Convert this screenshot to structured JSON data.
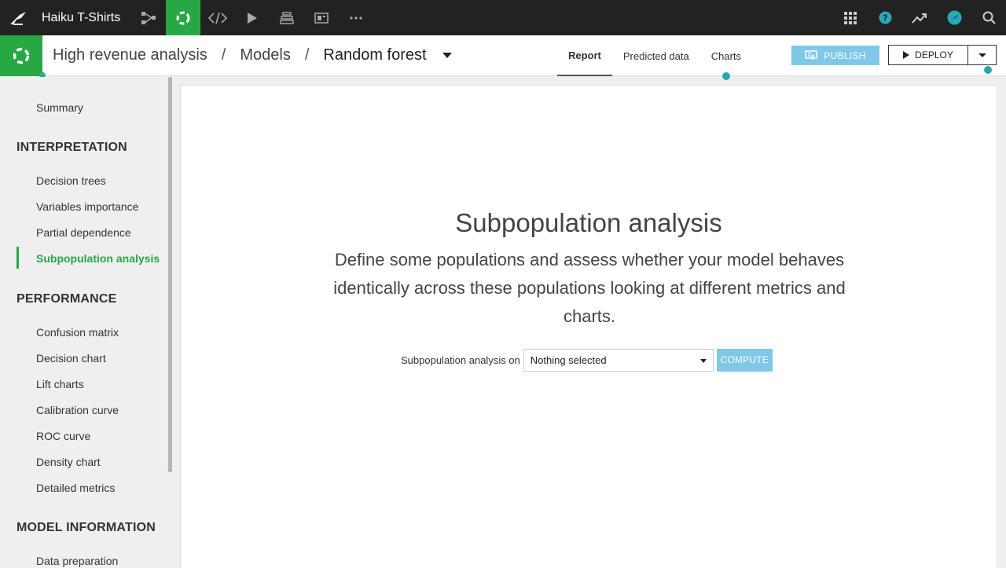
{
  "topbar": {
    "project_name": "Haiku T-Shirts",
    "nav_icons": [
      "flow-icon",
      "lab-icon",
      "code-icon",
      "run-icon",
      "deploy-stack-icon",
      "dashboard-icon",
      "more-icon"
    ],
    "right_icons": [
      "apps-grid-icon",
      "help-icon",
      "trend-icon",
      "user-avatar-icon",
      "search-icon"
    ],
    "accent": "#28a745",
    "dark": "#222222"
  },
  "breadcrumb": {
    "items": [
      "High revenue analysis",
      "Models",
      "Random forest"
    ]
  },
  "tabs": [
    {
      "label": "Report",
      "active": true
    },
    {
      "label": "Predicted data",
      "active": false
    },
    {
      "label": "Charts",
      "active": false
    }
  ],
  "actions": {
    "publish_label": "PUBLISH",
    "deploy_label": "DEPLOY"
  },
  "sidebar": {
    "summary": "Summary",
    "sections": [
      {
        "title": "INTERPRETATION",
        "items": [
          "Decision trees",
          "Variables importance",
          "Partial dependence",
          "Subpopulation analysis"
        ]
      },
      {
        "title": "PERFORMANCE",
        "items": [
          "Confusion matrix",
          "Decision chart",
          "Lift charts",
          "Calibration curve",
          "ROC curve",
          "Density chart",
          "Detailed metrics"
        ]
      },
      {
        "title": "MODEL INFORMATION",
        "items": [
          "Data preparation"
        ]
      }
    ],
    "active_item": "Subpopulation analysis"
  },
  "main": {
    "title": "Subpopulation analysis",
    "description": "Define some populations and assess whether your model behaves identically across these populations looking at different metrics and charts.",
    "form_label": "Subpopulation analysis on",
    "select_value": "Nothing selected",
    "compute_label": "COMPUTE"
  }
}
